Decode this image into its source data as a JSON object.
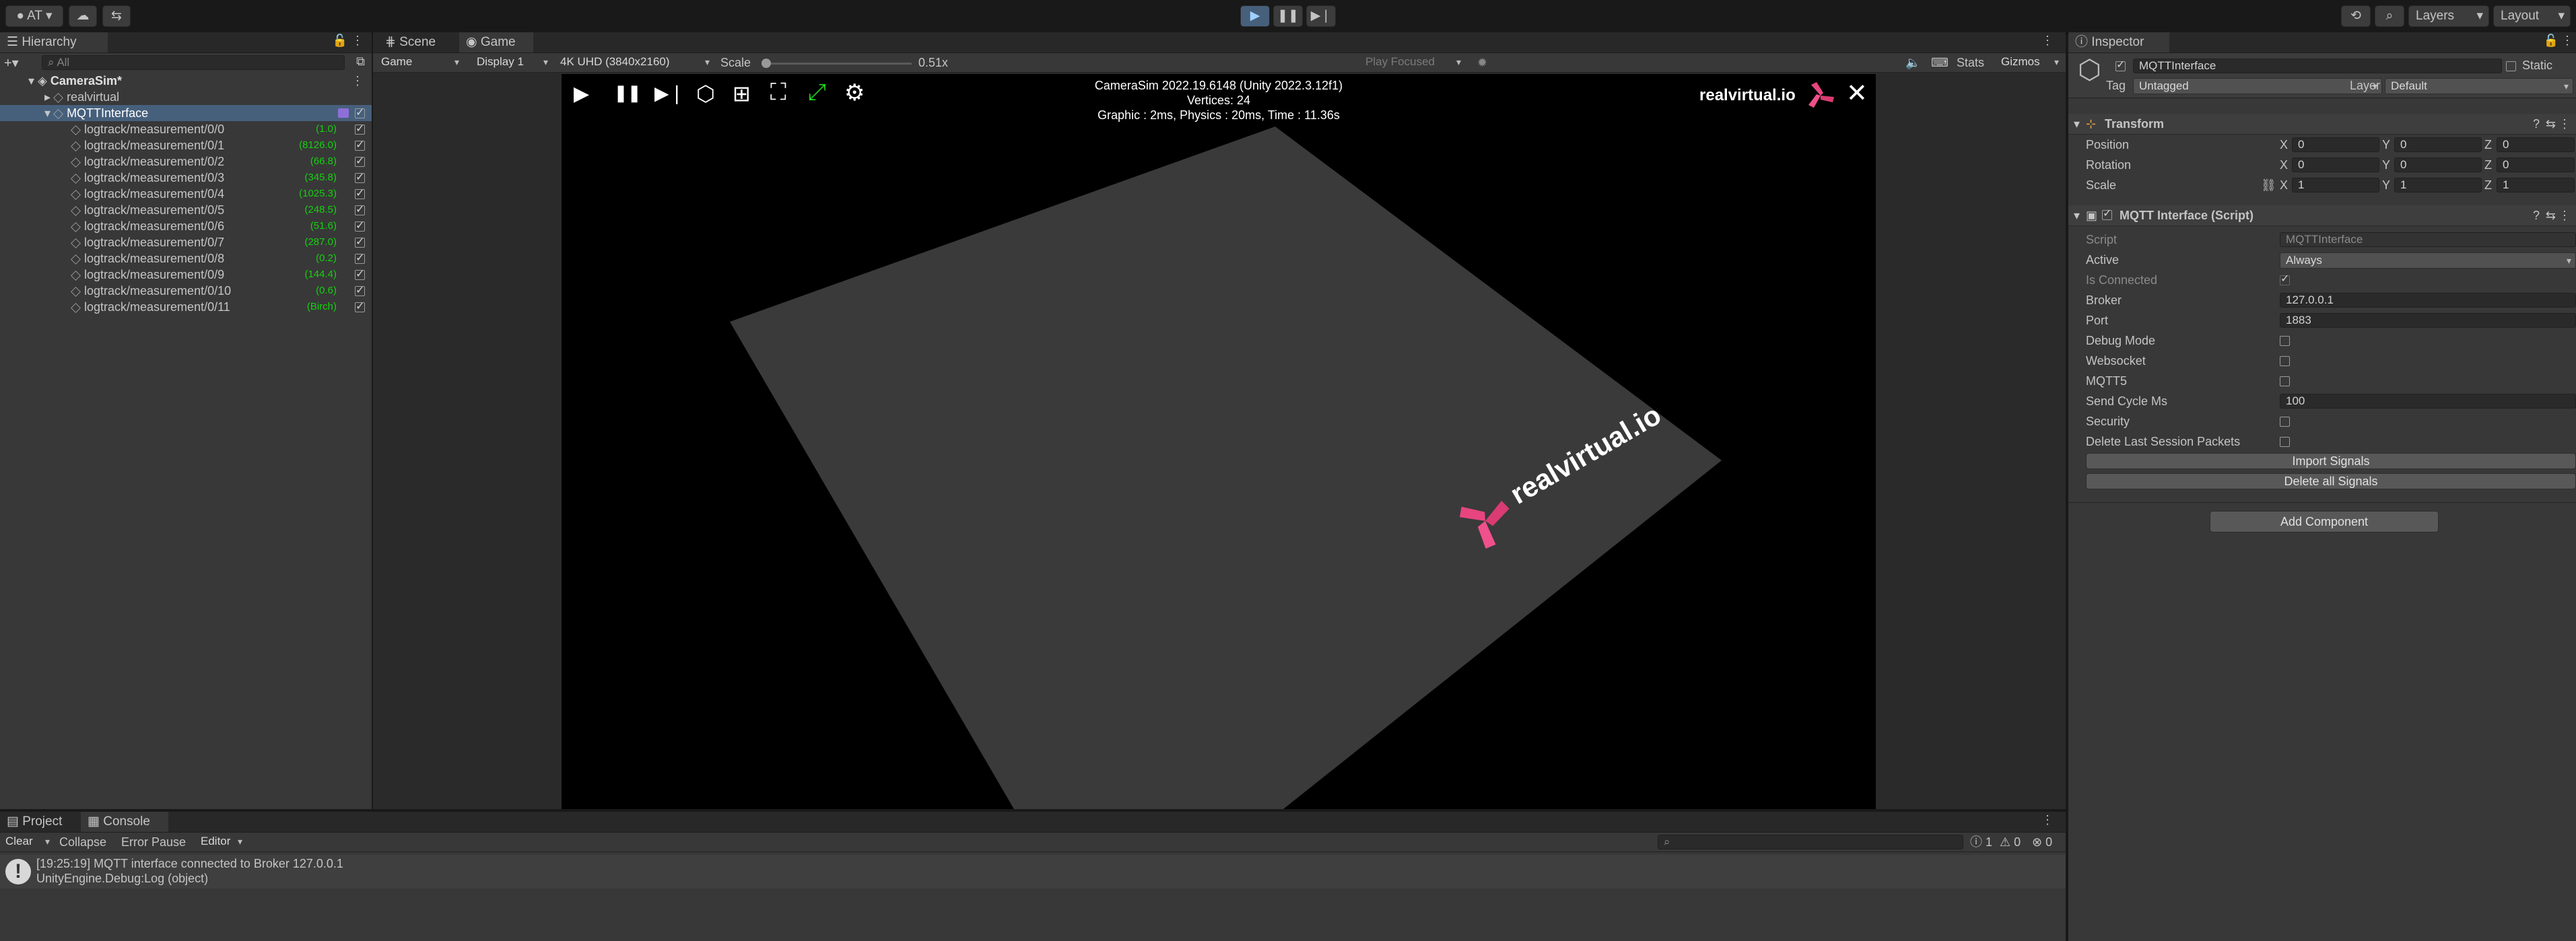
{
  "toolbar": {
    "account": "AT",
    "layers": "Layers",
    "layout": "Layout"
  },
  "hierarchy": {
    "title": "Hierarchy",
    "search_placeholder": "All",
    "scene": "CameraSim*",
    "root_item": "realvirtual",
    "parent_item": "MQTTInterface",
    "items": [
      {
        "name": "logtrack/measurement/0/0",
        "value": "(1.0)"
      },
      {
        "name": "logtrack/measurement/0/1",
        "value": "(8126.0)"
      },
      {
        "name": "logtrack/measurement/0/2",
        "value": "(66.8)"
      },
      {
        "name": "logtrack/measurement/0/3",
        "value": "(345.8)"
      },
      {
        "name": "logtrack/measurement/0/4",
        "value": "(1025.3)"
      },
      {
        "name": "logtrack/measurement/0/5",
        "value": "(248.5)"
      },
      {
        "name": "logtrack/measurement/0/6",
        "value": "(51.6)"
      },
      {
        "name": "logtrack/measurement/0/7",
        "value": "(287.0)"
      },
      {
        "name": "logtrack/measurement/0/8",
        "value": "(0.2)"
      },
      {
        "name": "logtrack/measurement/0/9",
        "value": "(144.4)"
      },
      {
        "name": "logtrack/measurement/0/10",
        "value": "(0.6)"
      },
      {
        "name": "logtrack/measurement/0/11",
        "value": "(Birch)"
      }
    ]
  },
  "game": {
    "tabs": [
      "Scene",
      "Game"
    ],
    "mode": "Game",
    "display": "Display 1",
    "resolution": "4K UHD (3840x2160)",
    "scale_label": "Scale",
    "scale_value": "0.51x",
    "scale_level": 0.02,
    "play_focused": "Play Focused",
    "stats": "Stats",
    "gizmos": "Gizmos",
    "overlay_line1": "CameraSim 2022.19.6148 (Unity 2022.3.12f1)",
    "overlay_line2": "Vertices: 24",
    "overlay_line3": "Graphic : 2ms, Physics : 20ms, Time : 11.36s",
    "brand": "realvirtual.io",
    "floor_logo": "realvirtual.io",
    "accent_color": "#e8457f"
  },
  "console": {
    "tabs": [
      "Project",
      "Console"
    ],
    "clear": "Clear",
    "collapse": "Collapse",
    "error_pause": "Error Pause",
    "editor": "Editor",
    "count_info": "1",
    "count_warn": "0",
    "count_error": "0",
    "message_line1": "[19:25:19] MQTT interface connected to Broker 127.0.0.1",
    "message_line2": "UnityEngine.Debug:Log (object)"
  },
  "inspector": {
    "title": "Inspector",
    "object_name": "MQTTInterface",
    "static_label": "Static",
    "tag_label": "Tag",
    "tag_value": "Untagged",
    "layer_label": "Layer",
    "layer_value": "Default",
    "transform_title": "Transform",
    "position_label": "Position",
    "rotation_label": "Rotation",
    "scale_label": "Scale",
    "position": [
      "0",
      "0",
      "0"
    ],
    "rotation": [
      "0",
      "0",
      "0"
    ],
    "scale": [
      "1",
      "1",
      "1"
    ],
    "axis": [
      "X",
      "Y",
      "Z"
    ],
    "component_title": "MQTT Interface (Script)",
    "props": {
      "script_label": "Script",
      "script_value": "MQTTInterface",
      "active_label": "Active",
      "active_value": "Always",
      "is_connected_label": "Is Connected",
      "broker_label": "Broker",
      "broker_value": "127.0.0.1",
      "port_label": "Port",
      "port_value": "1883",
      "debug_mode_label": "Debug Mode",
      "websocket_label": "Websocket",
      "mqtt5_label": "MQTT5",
      "send_cycle_label": "Send Cycle Ms",
      "send_cycle_value": "100",
      "security_label": "Security",
      "delete_last_label": "Delete Last Session Packets"
    },
    "import_signals": "Import Signals",
    "delete_signals": "Delete all Signals",
    "add_component": "Add Component"
  }
}
